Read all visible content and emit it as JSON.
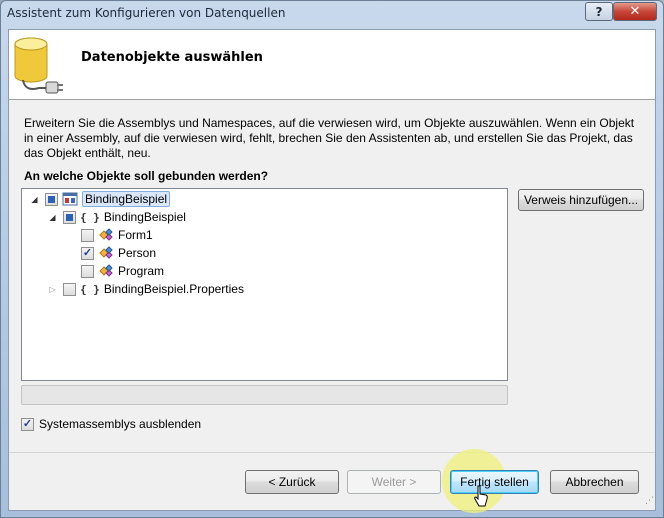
{
  "window": {
    "title": "Assistent zum Konfigurieren von Datenquellen",
    "help_icon": "?",
    "close_icon": "✕"
  },
  "header": {
    "title": "Datenobjekte auswählen",
    "icon": "database-plug-icon"
  },
  "description": "Erweitern Sie die Assemblys und Namespaces, auf die verwiesen wird, um Objekte auszuwählen. Wenn ein Objekt in einer Assembly, auf die verwiesen wird, fehlt, brechen Sie den Assistenten ab, und erstellen Sie das Projekt, das das Objekt enthält, neu.",
  "question": "An welche Objekte soll gebunden werden?",
  "tree": {
    "nodes": [
      {
        "label": "BindingBeispiel",
        "type": "assembly",
        "state": "partial",
        "expanded": true
      },
      {
        "label": "BindingBeispiel",
        "type": "namespace",
        "state": "partial",
        "expanded": true
      },
      {
        "label": "Form1",
        "type": "class",
        "state": "unchecked"
      },
      {
        "label": "Person",
        "type": "class",
        "state": "checked"
      },
      {
        "label": "Program",
        "type": "class",
        "state": "unchecked"
      },
      {
        "label": "BindingBeispiel.Properties",
        "type": "namespace",
        "state": "unchecked",
        "expanded": false
      }
    ],
    "namespace_glyph": "{ }"
  },
  "add_reference_button": "Verweis hinzufügen...",
  "hide_system_assemblies": {
    "label": "Systemassemblys ausblenden",
    "checked": true
  },
  "buttons": {
    "back": "< Zurück",
    "next": "Weiter >",
    "finish": "Fertig stellen",
    "cancel": "Abbrechen"
  },
  "colors": {
    "selection": "#d9e7f9",
    "highlight": "#f0f078"
  }
}
